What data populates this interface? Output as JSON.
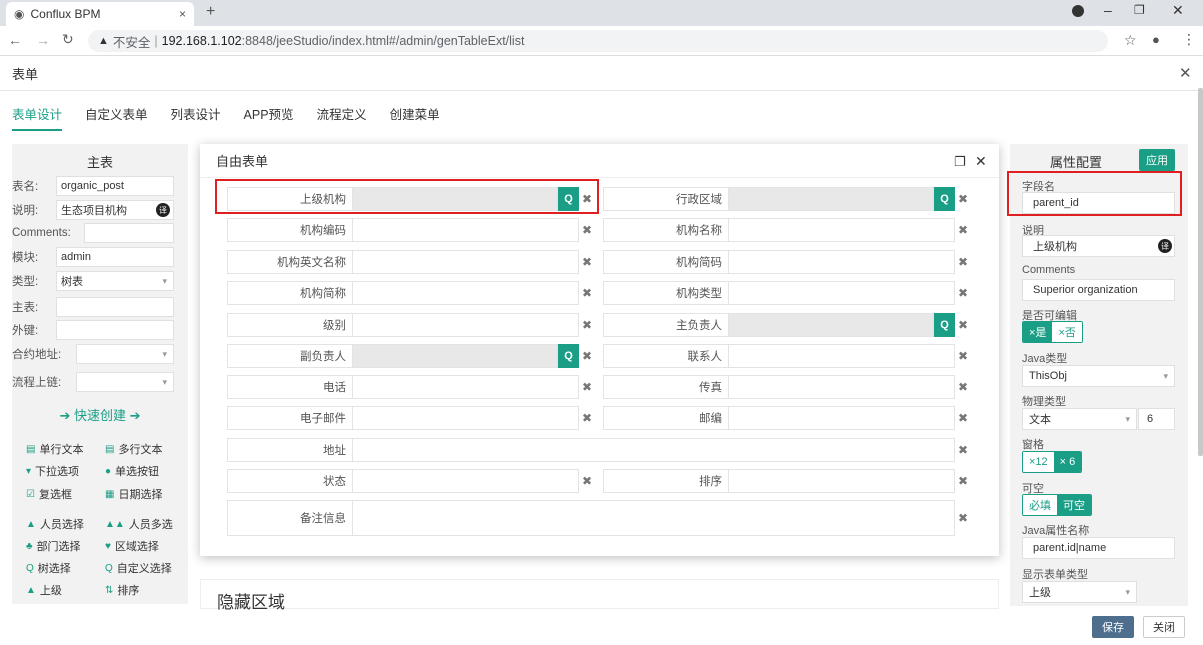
{
  "browser": {
    "tab_title": "Conflux BPM",
    "insecure": "不安全",
    "host": "192.168.1.102",
    "path": ":8848/jeeStudio/index.html#/admin/genTableExt/list"
  },
  "page": {
    "title": "表单",
    "tabs": [
      "表单设计",
      "自定义表单",
      "列表设计",
      "APP预览",
      "流程定义",
      "创建菜单"
    ]
  },
  "left": {
    "title": "主表",
    "table_name_label": "表名:",
    "table_name": "organic_post",
    "desc_label": "说明:",
    "desc": "生态项目机构",
    "comments_label": "Comments:",
    "module_label": "模块:",
    "module": "admin",
    "type_label": "类型:",
    "type": "树表",
    "main_label": "主表:",
    "fk_label": "外键:",
    "contract_label": "合约地址:",
    "chain_label": "流程上链:",
    "quick": "快速创建",
    "components": [
      "单行文本",
      "多行文本",
      "下拉选项",
      "单选按钮",
      "复选框",
      "日期选择",
      "人员选择",
      "人员多选",
      "部门选择",
      "区域选择",
      "树选择",
      "自定义选择",
      "上级",
      "排序"
    ]
  },
  "modal": {
    "title": "自由表单",
    "fields": [
      "上级机构",
      "行政区域",
      "机构编码",
      "机构名称",
      "机构英文名称",
      "机构简码",
      "机构简称",
      "机构类型",
      "级别",
      "主负责人",
      "副负责人",
      "联系人",
      "电话",
      "传真",
      "电子邮件",
      "邮编",
      "地址",
      "状态",
      "排序",
      "备注信息"
    ]
  },
  "hidden": {
    "title": "隐藏区域"
  },
  "right": {
    "title": "属性配置",
    "apply": "应用",
    "field_name_label": "字段名",
    "field_name": "parent_id",
    "desc_label": "说明",
    "desc": "上级机构",
    "comments_label": "Comments",
    "comments": "Superior organization",
    "editable_label": "是否可编辑",
    "yes": "×是",
    "no": "×否",
    "java_type_label": "Java类型",
    "java_type": "ThisObj",
    "phys_label": "物理类型",
    "phys": "文本",
    "phys_len": "6",
    "grid_label": "窗格",
    "grid12": "×12",
    "grid6": "× 6",
    "null_label": "可空",
    "required": "必填",
    "nullable": "可空",
    "java_attr_label": "Java属性名称",
    "java_attr": "parent.id|name",
    "show_type_label": "显示表单类型",
    "show_type": "上级"
  },
  "footer": {
    "save": "保存",
    "close": "关闭"
  },
  "colors": {
    "accent": "#1a9e85",
    "highlight": "#e02020"
  }
}
